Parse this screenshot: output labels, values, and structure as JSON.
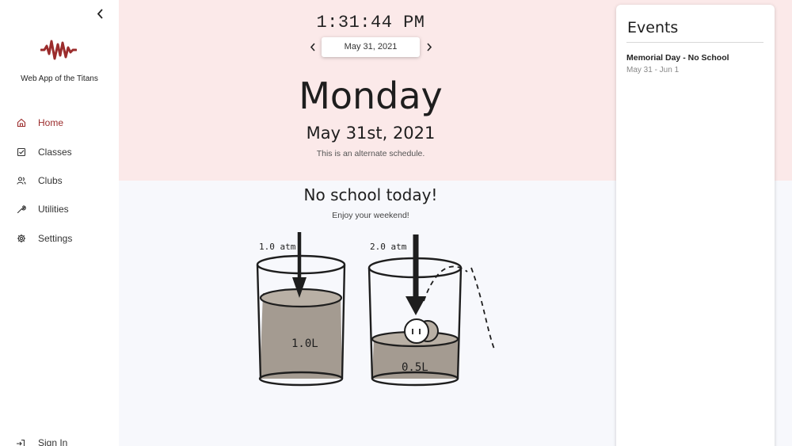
{
  "sidebar": {
    "app_name": "Web App of the Titans",
    "items": [
      {
        "label": "Home",
        "icon": "home-icon",
        "active": true
      },
      {
        "label": "Classes",
        "icon": "checkbox-icon",
        "active": false
      },
      {
        "label": "Clubs",
        "icon": "users-icon",
        "active": false
      },
      {
        "label": "Utilities",
        "icon": "wrench-icon",
        "active": false
      },
      {
        "label": "Settings",
        "icon": "gear-icon",
        "active": false
      }
    ],
    "sign_in": "Sign In"
  },
  "header": {
    "clock": "1:31:44 PM",
    "date_picker": "May 31, 2021",
    "day_name": "Monday",
    "date_full": "May 31st, 2021",
    "schedule_note": "This is an alternate schedule."
  },
  "main": {
    "headline": "No school today!",
    "subline": "Enjoy your weekend!",
    "illustration": {
      "left_pressure": "1.0 atm",
      "left_volume": "1.0L",
      "right_pressure": "2.0 atm",
      "right_volume": "0.5L"
    }
  },
  "events": {
    "title": "Events",
    "items": [
      {
        "name": "Memorial Day - No School",
        "dates": "May 31 - Jun 1"
      }
    ]
  },
  "colors": {
    "accent": "#9b2c2c",
    "top_band": "#fbe9e9",
    "bottom_band": "#f7f8fc"
  }
}
